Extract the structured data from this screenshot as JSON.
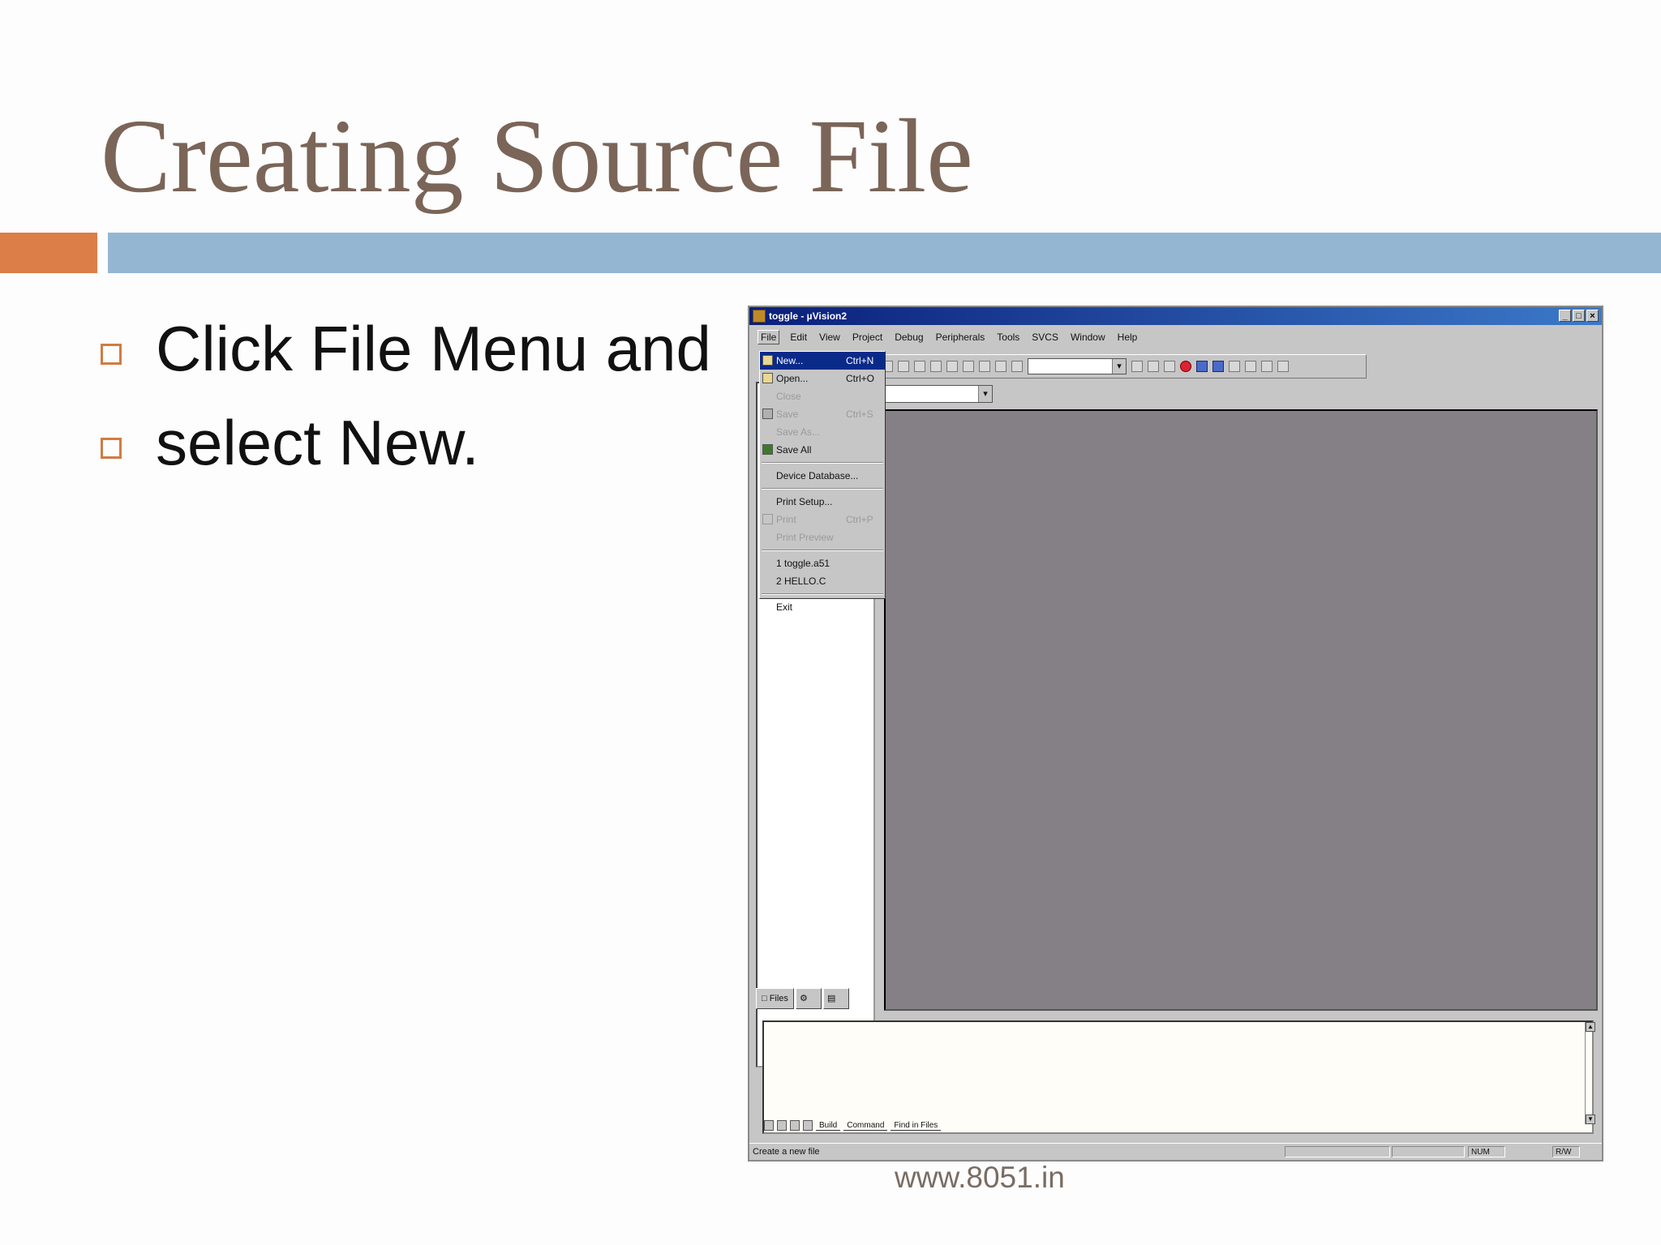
{
  "slide": {
    "title": "Creating Source File",
    "bullets": [
      "Click File Menu and",
      "select New."
    ],
    "footer": "www.8051.in",
    "colors": {
      "title": "#7a6558",
      "accent_orange": "#dc7e47",
      "accent_blue": "#95b6d2"
    }
  },
  "window": {
    "title": "toggle - µVision2",
    "controls": [
      "_",
      "□",
      "×"
    ],
    "menu": [
      "File",
      "Edit",
      "View",
      "Project",
      "Debug",
      "Peripherals",
      "Tools",
      "SVCS",
      "Window",
      "Help"
    ],
    "file_menu": {
      "items": [
        {
          "label": "New...",
          "shortcut": "Ctrl+N",
          "state": "selected",
          "icon": "new-file-icon"
        },
        {
          "label": "Open...",
          "shortcut": "Ctrl+O",
          "state": "enabled",
          "icon": "open-folder-icon"
        },
        {
          "label": "Close",
          "shortcut": "",
          "state": "disabled",
          "icon": ""
        },
        {
          "label": "Save",
          "shortcut": "Ctrl+S",
          "state": "disabled",
          "icon": "save-icon"
        },
        {
          "label": "Save As...",
          "shortcut": "",
          "state": "disabled",
          "icon": ""
        },
        {
          "label": "Save All",
          "shortcut": "",
          "state": "enabled",
          "icon": "save-all-icon"
        }
      ],
      "device_database": "Device Database...",
      "print_setup": "Print Setup...",
      "print": "Print",
      "print_shortcut": "Ctrl+P",
      "print_preview": "Print Preview",
      "recent": [
        "1 toggle.a51",
        "2 HELLO.C"
      ],
      "exit": "Exit"
    },
    "project_tabs": [
      "Files"
    ],
    "output_tabs": [
      "Build",
      "Command",
      "Find in Files"
    ],
    "status": {
      "message": "Create a new file",
      "num": "NUM",
      "rw": "R/W"
    }
  }
}
